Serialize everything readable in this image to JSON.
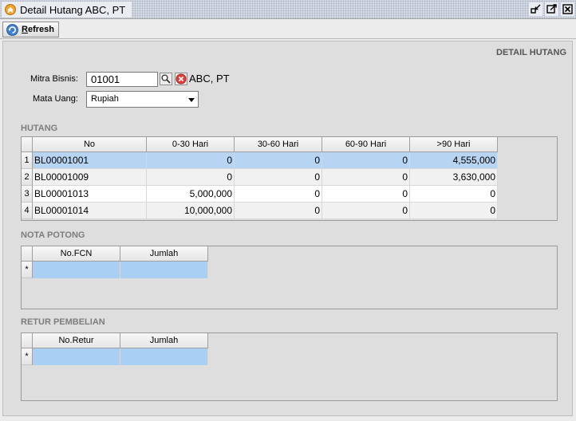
{
  "window": {
    "title": "Detail Hutang ABC, PT"
  },
  "toolbar": {
    "refresh_label_first": "R",
    "refresh_label_rest": "efresh"
  },
  "panel": {
    "header": "DETAIL HUTANG"
  },
  "form": {
    "mitra_label": "Mitra Bisnis:",
    "mitra_value": "01001",
    "mitra_name": "ABC, PT",
    "currency_label": "Mata Uang:",
    "currency_value": "Rupiah"
  },
  "hutang": {
    "title": "HUTANG",
    "columns": [
      "No",
      "0-30 Hari",
      "30-60 Hari",
      "60-90 Hari",
      ">90 Hari"
    ],
    "rows": [
      {
        "n": "1",
        "no": "BL00001001",
        "c1": "0",
        "c2": "0",
        "c3": "0",
        "c4": "4,555,000"
      },
      {
        "n": "2",
        "no": "BL00001009",
        "c1": "0",
        "c2": "0",
        "c3": "0",
        "c4": "3,630,000"
      },
      {
        "n": "3",
        "no": "BL00001013",
        "c1": "5,000,000",
        "c2": "0",
        "c3": "0",
        "c4": "0"
      },
      {
        "n": "4",
        "no": "BL00001014",
        "c1": "10,000,000",
        "c2": "0",
        "c3": "0",
        "c4": "0"
      }
    ]
  },
  "nota_potong": {
    "title": "NOTA POTONG",
    "columns": [
      "No.FCN",
      "Jumlah"
    ],
    "new_row_marker": "*"
  },
  "retur_pembelian": {
    "title": "RETUR PEMBELIAN",
    "columns": [
      "No.Retur",
      "Jumlah"
    ],
    "new_row_marker": "*"
  },
  "colors": {
    "selected_row": "#b7d4f2",
    "new_row": "#a9cff5",
    "app_icon": "#f2a32b"
  }
}
